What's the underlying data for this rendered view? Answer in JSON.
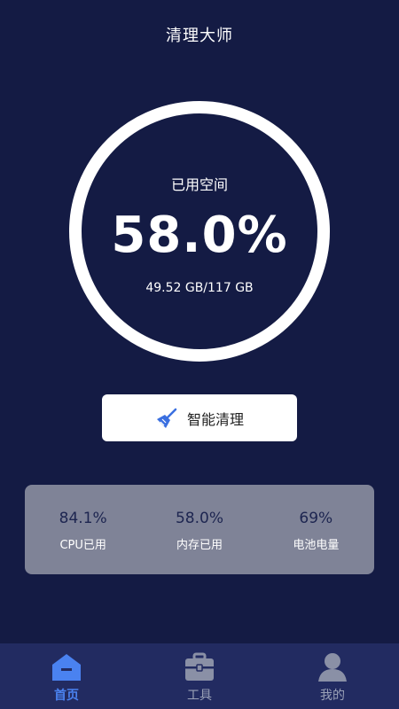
{
  "header": {
    "title": "清理大师"
  },
  "storage": {
    "label": "已用空间",
    "percent_text": "58.0%",
    "percent": 0.58,
    "detail": "49.52 GB/117 GB"
  },
  "clean_button": {
    "label": "智能清理",
    "icon": "broom-icon"
  },
  "stats": [
    {
      "value": "84.1%",
      "label": "CPU已用"
    },
    {
      "value": "58.0%",
      "label": "内存已用"
    },
    {
      "value": "69%",
      "label": "电池电量"
    }
  ],
  "tabs": [
    {
      "label": "首页",
      "icon": "home-icon",
      "active": true
    },
    {
      "label": "工具",
      "icon": "briefcase-icon",
      "active": false
    },
    {
      "label": "我的",
      "icon": "user-icon",
      "active": false
    }
  ],
  "colors": {
    "background": "#141b44",
    "accent": "#4a82f0",
    "panel": "#7f8397",
    "tabbar": "#222b61"
  }
}
